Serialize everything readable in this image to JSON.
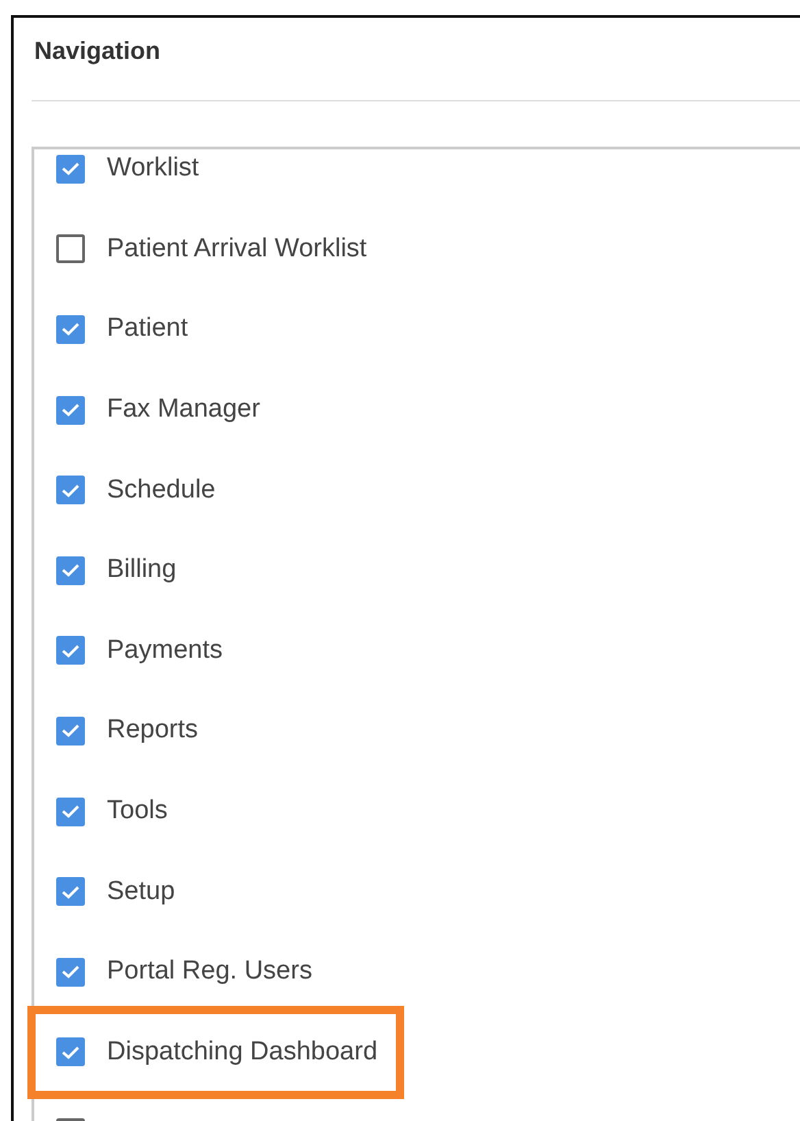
{
  "panel": {
    "title": "Navigation"
  },
  "items": [
    {
      "label": "Worklist",
      "checked": true,
      "highlighted": false
    },
    {
      "label": "Patient Arrival Worklist",
      "checked": false,
      "highlighted": false
    },
    {
      "label": "Patient",
      "checked": true,
      "highlighted": false
    },
    {
      "label": "Fax Manager",
      "checked": true,
      "highlighted": false
    },
    {
      "label": "Schedule",
      "checked": true,
      "highlighted": false
    },
    {
      "label": "Billing",
      "checked": true,
      "highlighted": false
    },
    {
      "label": "Payments",
      "checked": true,
      "highlighted": false
    },
    {
      "label": "Reports",
      "checked": true,
      "highlighted": false
    },
    {
      "label": "Tools",
      "checked": true,
      "highlighted": false
    },
    {
      "label": "Setup",
      "checked": true,
      "highlighted": false
    },
    {
      "label": "Portal Reg. Users",
      "checked": true,
      "highlighted": false
    },
    {
      "label": "Dispatching Dashboard",
      "checked": true,
      "highlighted": true
    },
    {
      "checked": false,
      "highlighted": false
    }
  ]
}
